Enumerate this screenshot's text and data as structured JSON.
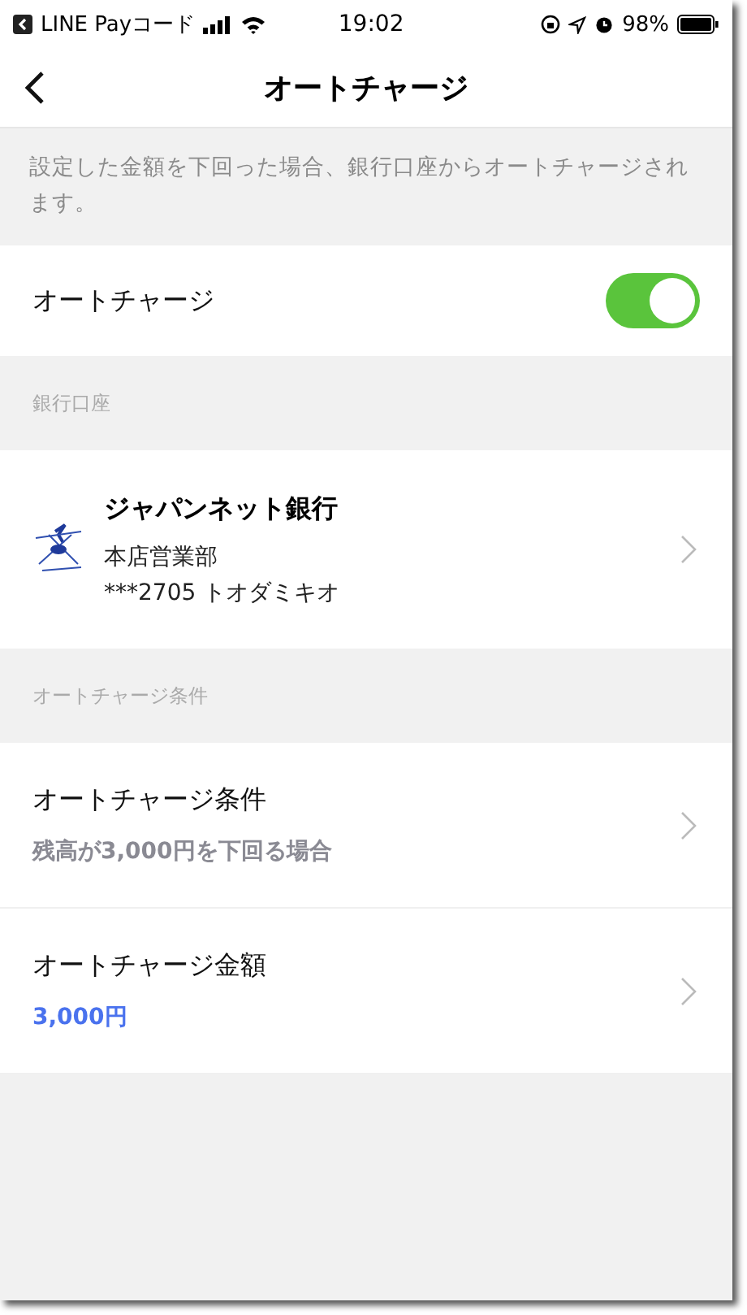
{
  "status_bar": {
    "back_app": "LINE Payコード",
    "time": "19:02",
    "battery": "98%"
  },
  "nav": {
    "title": "オートチャージ"
  },
  "description": "設定した金額を下回った場合、銀行口座からオートチャージされます。",
  "toggle": {
    "label": "オートチャージ",
    "on": true
  },
  "bank_section": {
    "header": "銀行口座",
    "bank_name": "ジャパンネット銀行",
    "branch": "本店営業部",
    "account": "***2705 トオダミキオ"
  },
  "condition_section": {
    "header": "オートチャージ条件",
    "rows": [
      {
        "label": "オートチャージ条件",
        "value": "残高が3,000円を下回る場合",
        "kind": "muted"
      },
      {
        "label": "オートチャージ金額",
        "value": "3,000円",
        "kind": "accent"
      }
    ]
  }
}
